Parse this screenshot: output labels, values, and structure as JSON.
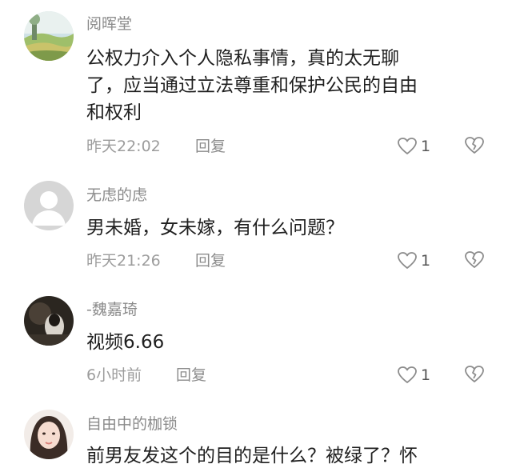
{
  "comments": [
    {
      "username": "阅晖堂",
      "lines": [
        "公权力介入个人隐私事情，真的太无聊",
        "了，应当通过立法尊重和保护公民的自由",
        "和权利"
      ],
      "time": "昨天22:02",
      "reply_label": "回复",
      "likes": "1",
      "avatar": "landscape-avatar"
    },
    {
      "username": "无虑的虑",
      "lines": [
        "男未婚，女未嫁，有什么问题？"
      ],
      "time": "昨天21:26",
      "reply_label": "回复",
      "likes": "1",
      "avatar": "default-gray-avatar"
    },
    {
      "username": "-魏嘉琦",
      "lines": [
        "视频6.66"
      ],
      "time": "6小时前",
      "reply_label": "回复",
      "likes": "1",
      "avatar": "dark-photo-avatar"
    },
    {
      "username": "自由中的枷锁",
      "lines": [
        "前男友发这个的目的是什么？被绿了？怀"
      ],
      "avatar": "portrait-avatar"
    }
  ],
  "colors": {
    "username": "#8a8a8a",
    "meta": "#9c9c9c",
    "text": "#1f1f1f"
  }
}
